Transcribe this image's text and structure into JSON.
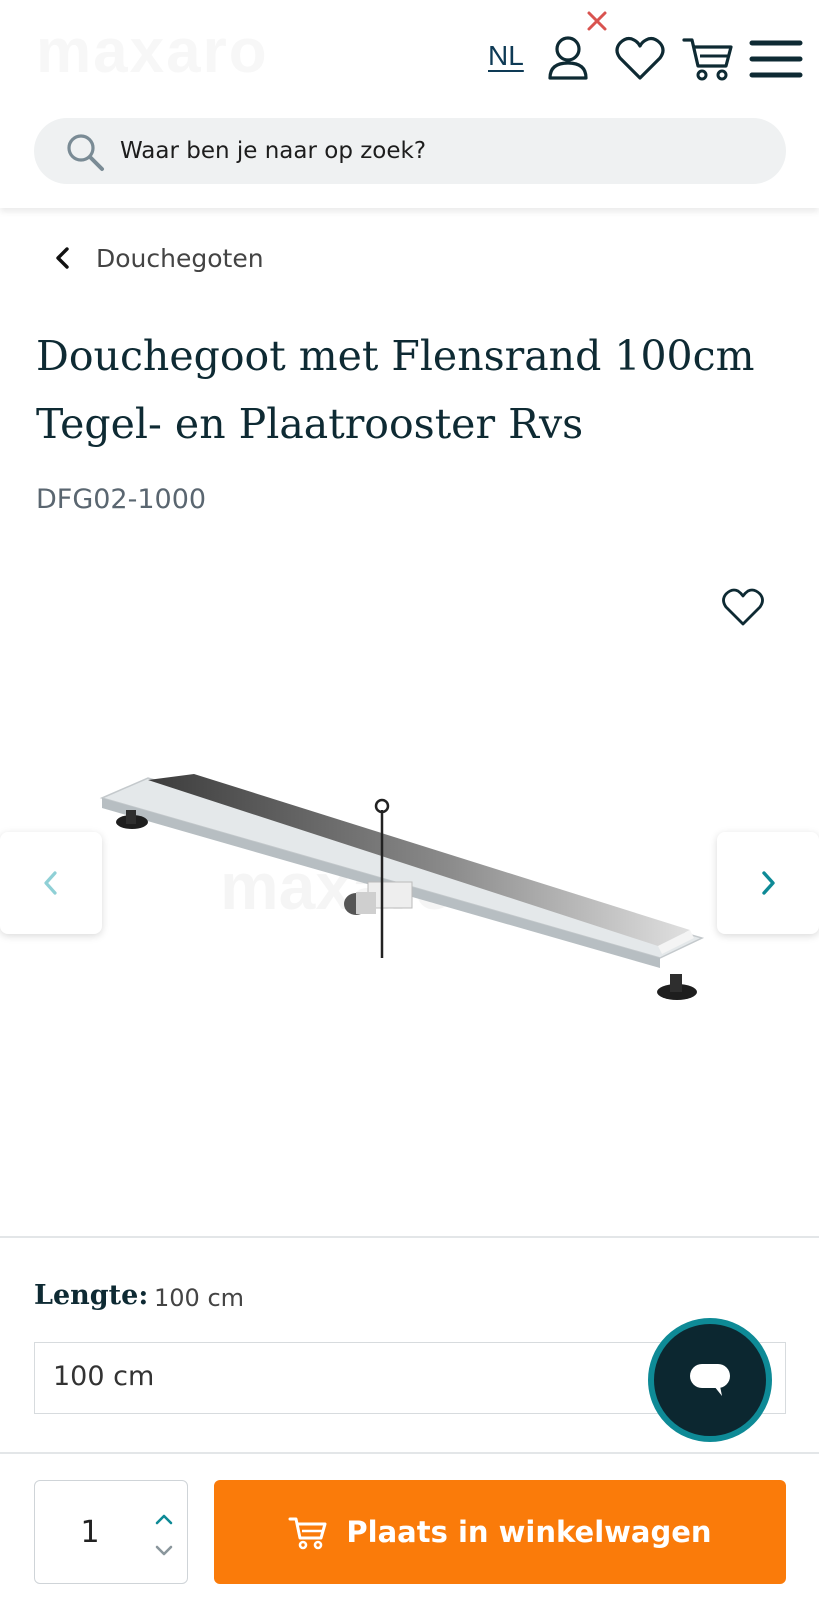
{
  "header": {
    "logo_text": "maxaro",
    "language": "NL",
    "icons": {
      "account": "user-icon",
      "notice": "close-icon",
      "wishlist": "heart-icon",
      "cart": "cart-icon",
      "menu": "menu-icon"
    },
    "search": {
      "placeholder": "Waar ben je naar op zoek?"
    }
  },
  "breadcrumb": {
    "label": "Douchegoten"
  },
  "product": {
    "title": "Douchegoot met Flensrand 100cm Tegel- en Plaatrooster Rvs",
    "sku": "DFG02-1000",
    "watermark": "maxaro"
  },
  "options": {
    "label": "Lengte:",
    "selected_value": "100 cm",
    "select_value": "100 cm"
  },
  "purchase": {
    "quantity": "1",
    "add_to_cart_label": "Plaats in winkelwagen"
  },
  "colors": {
    "accent_orange": "#fa7b0a",
    "navy": "#0e2a33",
    "teal": "#0e8a96",
    "close_red": "#d9534f"
  }
}
